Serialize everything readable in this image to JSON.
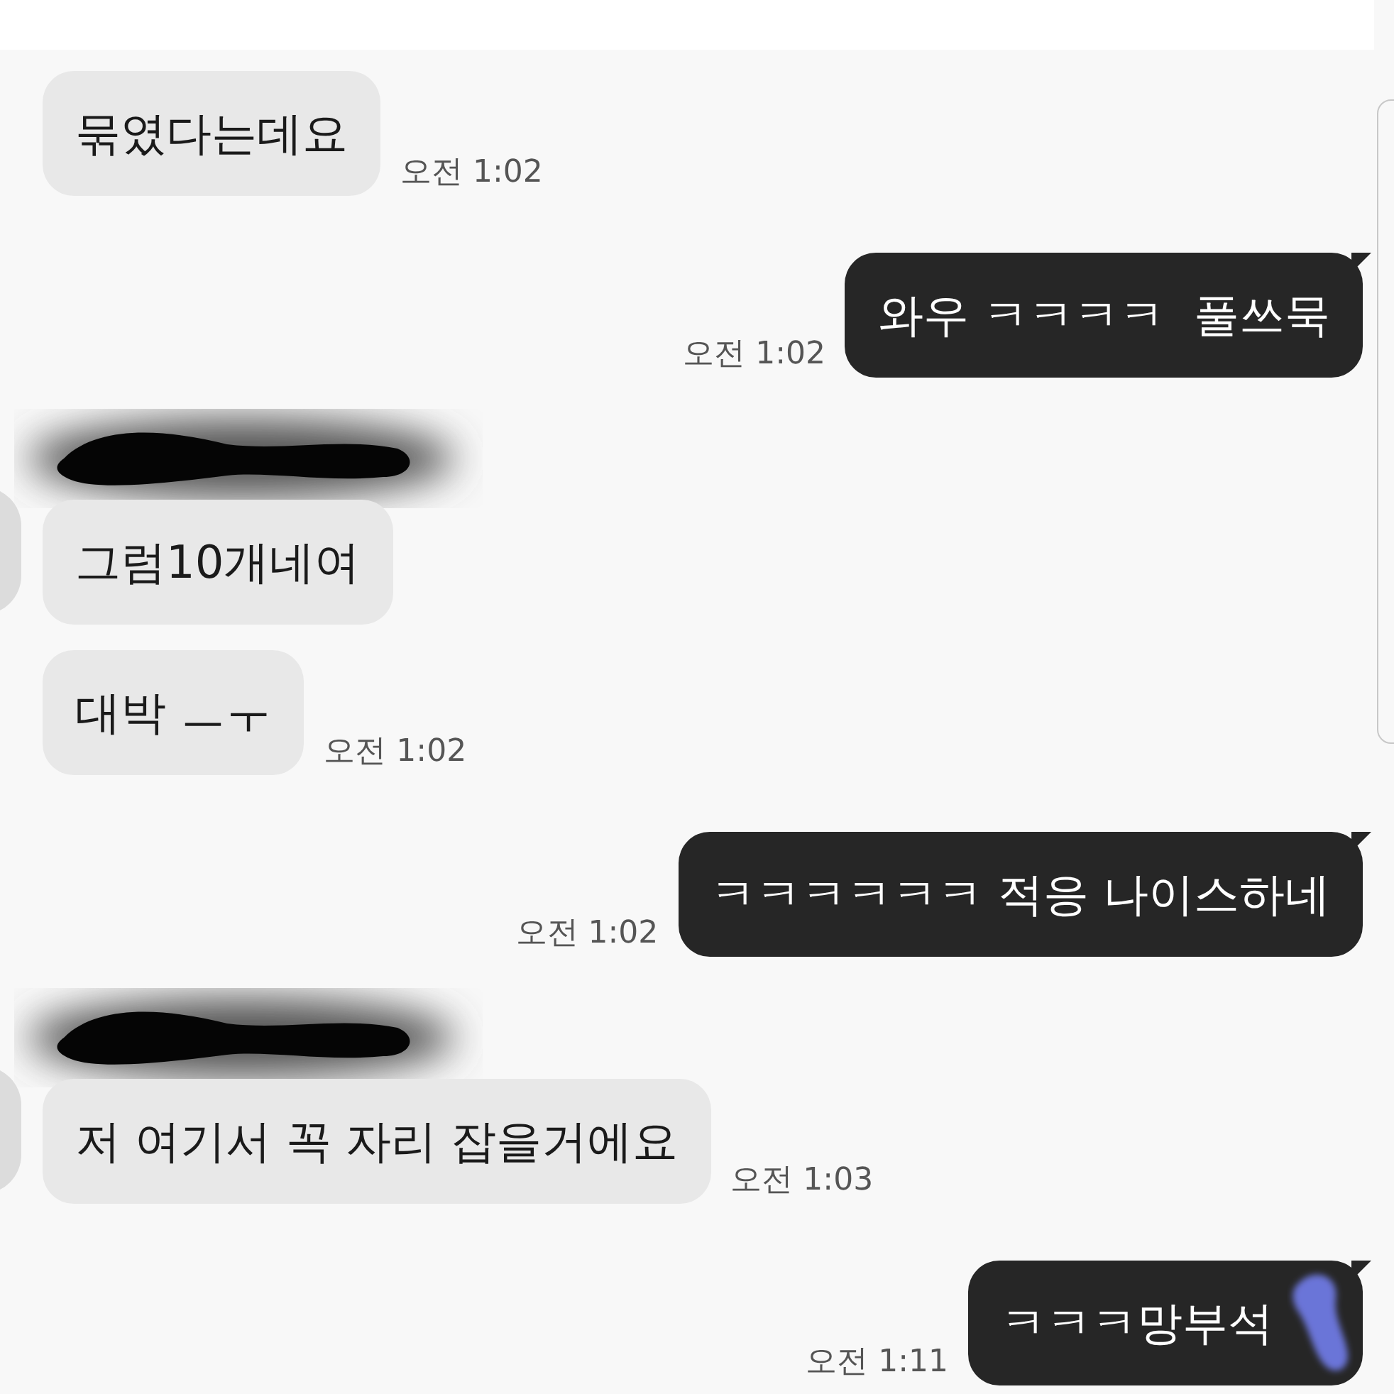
{
  "messages": [
    {
      "kind": "incoming",
      "text": "묶였다는데요",
      "time": "오전 1:02"
    },
    {
      "kind": "outgoing",
      "text": "와우 ㅋㅋㅋㅋ  풀쓰묵",
      "time": "오전 1:02"
    },
    {
      "kind": "hidden_sender"
    },
    {
      "kind": "incoming",
      "text": "그럼10개네여"
    },
    {
      "kind": "incoming",
      "text": "대박 ㅡㅜ",
      "time": "오전 1:02"
    },
    {
      "kind": "outgoing",
      "text": "ㅋㅋㅋㅋㅋㅋ 적응 나이스하네",
      "time": "오전 1:02"
    },
    {
      "kind": "hidden_sender"
    },
    {
      "kind": "incoming",
      "text": "저 여기서 꼭 자리 잡을거에요",
      "time": "오전 1:03"
    },
    {
      "kind": "outgoing",
      "text": "ㅋㅋㅋ망부석",
      "time": "오전 1:11",
      "smudged": true
    }
  ]
}
